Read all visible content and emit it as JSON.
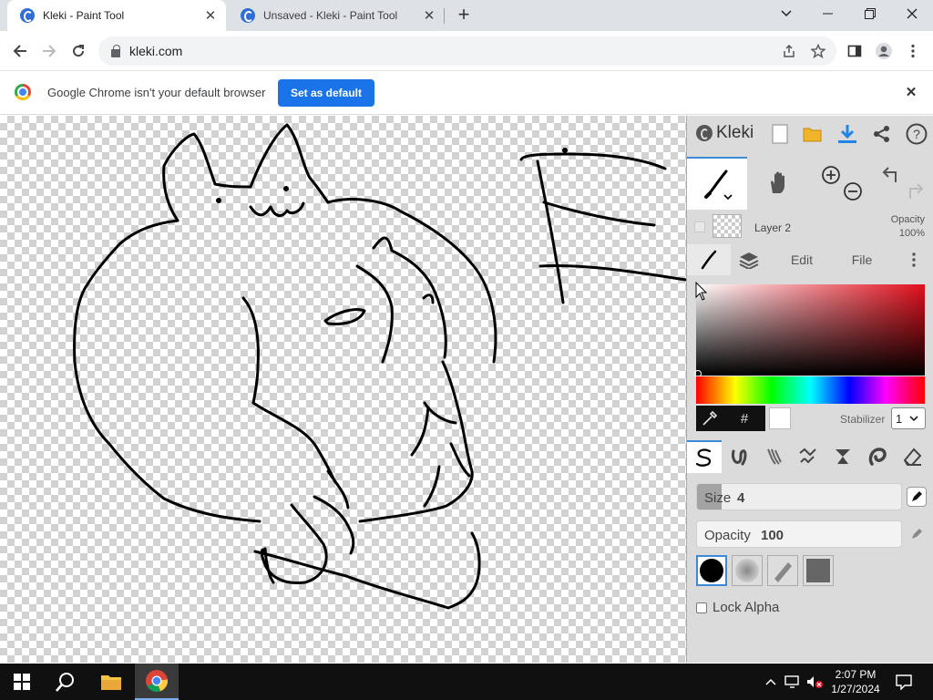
{
  "browser": {
    "tabs": [
      {
        "title": "Kleki - Paint Tool",
        "active": true
      },
      {
        "title": "Unsaved - Kleki - Paint Tool",
        "active": false
      }
    ],
    "url": "kleki.com",
    "infobar": {
      "message": "Google Chrome isn't your default browser",
      "button": "Set as default"
    }
  },
  "kleki": {
    "logo": "Kleki",
    "layer": {
      "name": "Layer 2",
      "opacity_label": "Opacity",
      "opacity_value": "100%"
    },
    "panel_tabs": [
      "Edit",
      "File"
    ],
    "stabilizer": {
      "label": "Stabilizer",
      "value": "1"
    },
    "color_hex_label": "#",
    "current_color": "#ffffff",
    "brush_size": {
      "label": "Size",
      "value": "4",
      "fraction": 0.12
    },
    "brush_opacity": {
      "label": "Opacity",
      "value": "100",
      "fraction": 1.0
    },
    "lock_alpha": "Lock Alpha"
  },
  "taskbar": {
    "time": "2:07 PM",
    "date": "1/27/2024"
  },
  "colors": {
    "accent": "#1a73e8",
    "kleki_accent": "#3a8ad8",
    "panel_bg": "#dbdbdb",
    "taskbar_bg": "#101010"
  },
  "icons": [
    "search-icon",
    "download-icon",
    "share-icon",
    "help-icon",
    "brush-icon",
    "hand-icon",
    "zoom-in-icon",
    "zoom-out-icon",
    "undo-icon",
    "redo-icon",
    "layers-icon",
    "eyedropper-icon",
    "eraser-icon",
    "windows-start-icon",
    "file-explorer-icon",
    "chrome-icon"
  ]
}
